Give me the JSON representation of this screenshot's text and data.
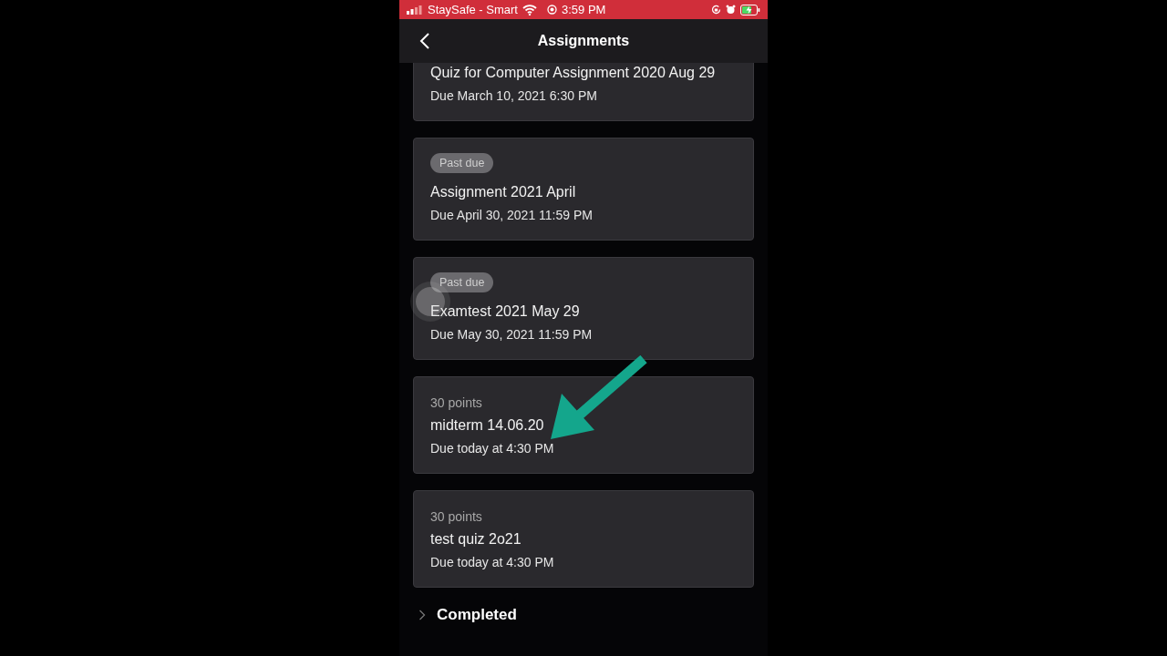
{
  "status_bar": {
    "carrier": "StaySafe - Smart",
    "time": "3:59 PM"
  },
  "header": {
    "title": "Assignments"
  },
  "assignments": [
    {
      "title": "Quiz for Computer Assignment 2020 Aug 29",
      "due": "Due March 10, 2021 6:30 PM"
    },
    {
      "badge": "Past due",
      "title": "Assignment 2021 April",
      "due": "Due April 30, 2021 11:59 PM"
    },
    {
      "badge": "Past due",
      "title": "Examtest 2021 May 29",
      "due": "Due May 30, 2021 11:59 PM"
    },
    {
      "points": "30 points",
      "title": "midterm 14.06.20",
      "due": "Due today at 4:30 PM"
    },
    {
      "points": "30 points",
      "title": "test quiz 2o21",
      "due": "Due today at 4:30 PM"
    }
  ],
  "completed_section": {
    "label": "Completed",
    "expanded": false
  }
}
